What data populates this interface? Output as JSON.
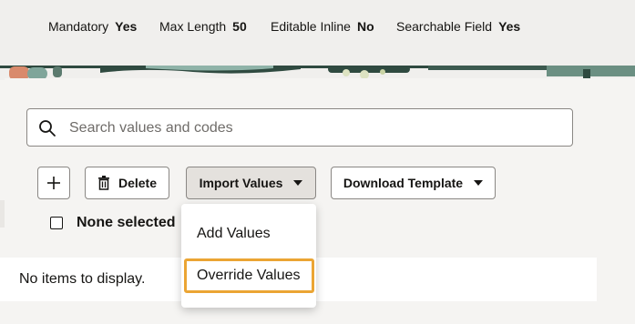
{
  "meta_fields": [
    {
      "label": "Mandatory",
      "value": "Yes"
    },
    {
      "label": "Max Length",
      "value": "50"
    },
    {
      "label": "Editable Inline",
      "value": "No"
    },
    {
      "label": "Searchable Field",
      "value": "Yes"
    }
  ],
  "search": {
    "placeholder": "Search values and codes",
    "value": ""
  },
  "toolbar": {
    "add_label": "+",
    "delete_label": "Delete",
    "import_label": "Import Values",
    "download_label": "Download Template"
  },
  "selection": {
    "label": "None selected"
  },
  "empty_message": "No items to display.",
  "import_menu": {
    "items": [
      {
        "label": "Add Values"
      },
      {
        "label": "Override Values",
        "focused": true
      }
    ]
  },
  "colors": {
    "focus_ring": "#eba534",
    "border": "#8a8784",
    "text": "#161513"
  }
}
